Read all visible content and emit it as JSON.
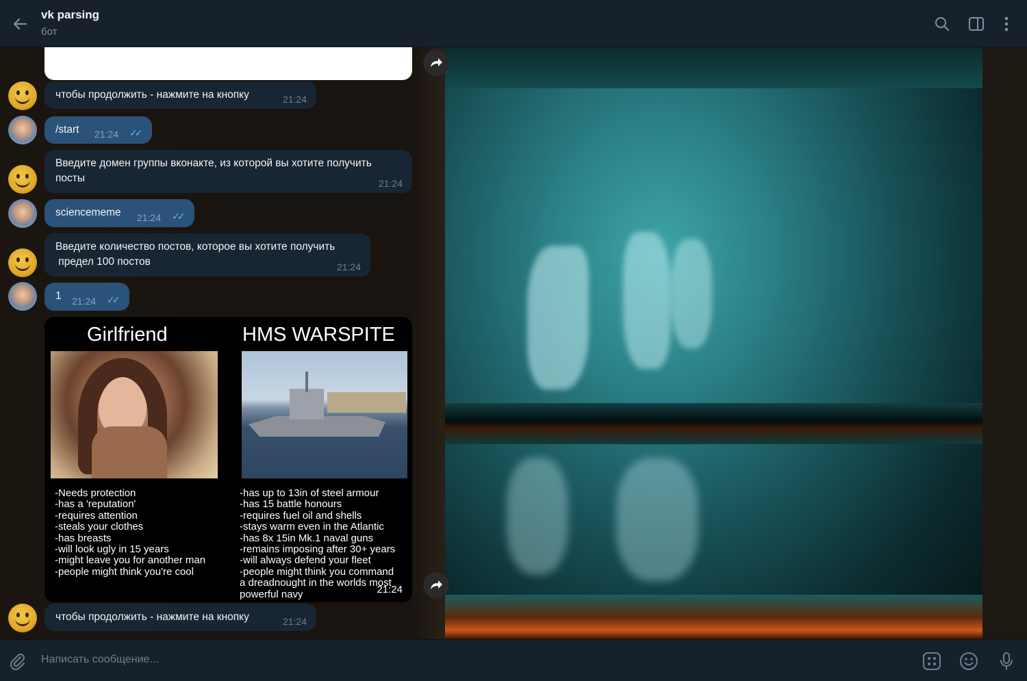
{
  "header": {
    "title": "vk parsing",
    "subtitle": "бот"
  },
  "messages": [
    {
      "text": "чтобы продолжить - нажмите на кнопку",
      "time": "21:24"
    },
    {
      "text": "/start",
      "time": "21:24"
    },
    {
      "line1": "Введите домен группы вконакте, из которой вы хотите получить",
      "line2": "посты",
      "time": "21:24"
    },
    {
      "text": "sciencememe",
      "time": "21:24"
    },
    {
      "line1": "Введите количество постов, которое вы хотите получить",
      "line2": " предел 100 постов",
      "time": "21:24"
    },
    {
      "text": "1",
      "time": "21:24"
    },
    {
      "text": "чтобы продолжить - нажмите на кнопку",
      "time": "21:24"
    }
  ],
  "meme": {
    "left_title": "Girlfriend",
    "right_title": "HMS WARSPITE",
    "left_list": "-Needs protection\n-has a 'reputation'\n-requires attention\n-steals your clothes\n-has breasts\n-will look ugly in 15 years\n-might leave you for another man\n-people might think you're cool",
    "right_list": "-has up to 13in of steel armour\n-has 15 battle honours\n-requires fuel oil and shells\n-stays warm even in the Atlantic\n-has 8x 15in Mk.1 naval guns\n-remains imposing after 30+ years\n-will always defend your fleet\n-people might think you command\na dreadnought in the worlds most\npowerful navy",
    "time": "21:24"
  },
  "composer": {
    "placeholder": "Написать сообщение..."
  },
  "icons": [
    "back-arrow-icon",
    "search-icon",
    "sidebar-toggle-icon",
    "more-vertical-icon",
    "forward-icon",
    "attach-icon",
    "bot-commands-icon",
    "emoji-icon",
    "microphone-icon"
  ]
}
